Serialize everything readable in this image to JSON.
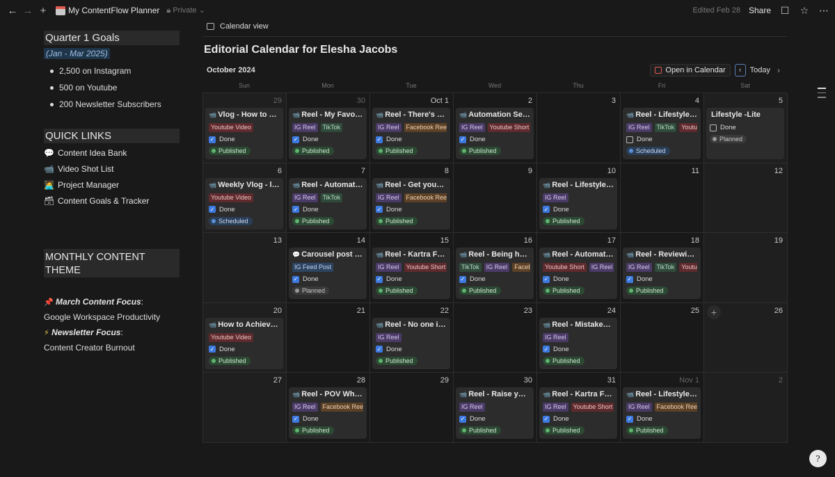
{
  "topbar": {
    "page_title": "My ContentFlow Planner",
    "privacy": "Private",
    "edited": "Edited Feb 28",
    "share": "Share"
  },
  "left": {
    "goals_heading": "Quarter 1 Goals",
    "goals_range": "(Jan - Mar 2025)",
    "goals": [
      "2,500 on Instagram",
      "500 on Youtube",
      "200 Newsletter Subscribers"
    ],
    "quick_heading": "QUICK LINKS",
    "quick_links": [
      {
        "emoji": "💬",
        "label": "Content Idea Bank"
      },
      {
        "emoji": "📹",
        "label": "Video Shot List"
      },
      {
        "emoji": "🧑‍💻",
        "label": "Project Manager"
      },
      {
        "emoji": "🗃",
        "label": "Content Goals & Tracker"
      }
    ],
    "theme_heading": "MONTHLY CONTENT THEME",
    "march_label": "March Content Focus",
    "march_value": "Google Workspace Productivity",
    "news_label": "Newsletter Focus",
    "news_value": "Content Creator Burnout",
    "pin_emoji": "📌",
    "bolt_emoji": "⚡"
  },
  "calendar": {
    "view_tab": "Calendar view",
    "title": "Editorial Calendar for Elesha Jacobs",
    "month": "October 2024",
    "open_in_calendar": "Open in Calendar",
    "today": "Today",
    "dows": [
      "Sun",
      "Mon",
      "Tue",
      "Wed",
      "Thu",
      "Fri",
      "Sat"
    ],
    "days": [
      {
        "num": "29",
        "dim": true,
        "card": {
          "emoji": "📹",
          "title": "Vlog - How to St...",
          "tags": [
            [
              "yt",
              "Youtube Video"
            ]
          ],
          "done": true,
          "status": [
            "pub",
            "Published"
          ]
        }
      },
      {
        "num": "30",
        "dim": true,
        "card": {
          "emoji": "📹",
          "title": "Reel - My Favorit...",
          "tags": [
            [
              "ig",
              "IG Reel"
            ],
            [
              "tt",
              "TikTok"
            ]
          ],
          "done": true,
          "status": [
            "pub",
            "Published"
          ]
        }
      },
      {
        "num": "Oct 1",
        "card": {
          "emoji": "📹",
          "title": "Reel - There's a ...",
          "tags": [
            [
              "ig",
              "IG Reel"
            ],
            [
              "fb",
              "Facebook Reel"
            ]
          ],
          "done": true,
          "status": [
            "pub",
            "Published"
          ]
        }
      },
      {
        "num": "2",
        "card": {
          "emoji": "📹",
          "title": "Automation Secr...",
          "tags": [
            [
              "ig",
              "IG Reel"
            ],
            [
              "yts",
              "Youtube Short"
            ]
          ],
          "done": true,
          "status": [
            "pub",
            "Published"
          ]
        }
      },
      {
        "num": "3"
      },
      {
        "num": "4",
        "card": {
          "emoji": "📹",
          "title": "Reel - Lifestyle:...",
          "tags": [
            [
              "ig",
              "IG Reel"
            ],
            [
              "tt",
              "TikTok"
            ],
            [
              "yt",
              "Youtu"
            ]
          ],
          "done": false,
          "status": [
            "sch",
            "Scheduled"
          ]
        }
      },
      {
        "num": "5",
        "card": {
          "emoji": "",
          "title": "Lifestyle -Lite",
          "tags": [],
          "done": false,
          "status": [
            "pln",
            "Planned"
          ]
        }
      },
      {
        "num": "6",
        "card": {
          "emoji": "📹",
          "title": "Weekly Vlog - le...",
          "tags": [
            [
              "yt",
              "Youtube Video"
            ]
          ],
          "done": true,
          "status": [
            "sch",
            "Scheduled"
          ]
        }
      },
      {
        "num": "7",
        "card": {
          "emoji": "📹",
          "title": "Reel - Automatio...",
          "tags": [
            [
              "ig",
              "IG Reel"
            ],
            [
              "tt",
              "TikTok"
            ]
          ],
          "done": true,
          "status": [
            "pub",
            "Published"
          ]
        }
      },
      {
        "num": "8",
        "card": {
          "emoji": "📹",
          "title": "Reel - Get your b...",
          "tags": [
            [
              "ig",
              "IG Reel"
            ],
            [
              "fb",
              "Facebook Reel"
            ]
          ],
          "done": true,
          "status": [
            "pub",
            "Published"
          ]
        }
      },
      {
        "num": "9"
      },
      {
        "num": "10",
        "card": {
          "emoji": "📹",
          "title": "Reel - Lifestyle: ...",
          "tags": [
            [
              "ig",
              "IG Reel"
            ]
          ],
          "done": true,
          "status": [
            "pub",
            "Published"
          ]
        }
      },
      {
        "num": "11"
      },
      {
        "num": "12"
      },
      {
        "num": "13"
      },
      {
        "num": "14",
        "card": {
          "emoji": "💬",
          "title": "Carousel post a...",
          "tags": [
            [
              "feed",
              "IG Feed Post"
            ]
          ],
          "done": true,
          "status": [
            "pln",
            "Planned"
          ]
        }
      },
      {
        "num": "15",
        "card": {
          "emoji": "📹",
          "title": "Reel - Kartra Fea...",
          "tags": [
            [
              "ig",
              "IG Reel"
            ],
            [
              "yts",
              "Youtube Short"
            ]
          ],
          "done": true,
          "status": [
            "pub",
            "Published"
          ]
        }
      },
      {
        "num": "16",
        "card": {
          "emoji": "📹",
          "title": "Reel - Being hel...",
          "tags": [
            [
              "tt",
              "TikTok"
            ],
            [
              "ig",
              "IG Reel"
            ],
            [
              "fb",
              "Faceb"
            ]
          ],
          "done": true,
          "status": [
            "pub",
            "Published"
          ]
        }
      },
      {
        "num": "17",
        "card": {
          "emoji": "📹",
          "title": "Reel - Automatio...",
          "tags": [
            [
              "yts",
              "Youtube Short"
            ],
            [
              "ig",
              "IG Reel"
            ]
          ],
          "done": true,
          "status": [
            "pub",
            "Published"
          ]
        }
      },
      {
        "num": "18",
        "card": {
          "emoji": "📹",
          "title": "Reel - Reviewing...",
          "tags": [
            [
              "ig",
              "IG Reel"
            ],
            [
              "tt",
              "TikTok"
            ],
            [
              "yt",
              "Youtu"
            ]
          ],
          "done": true,
          "status": [
            "pub",
            "Published"
          ]
        }
      },
      {
        "num": "19"
      },
      {
        "num": "20",
        "card": {
          "emoji": "📹",
          "title": "How to Achieve ...",
          "tags": [
            [
              "yt",
              "Youtube Video"
            ]
          ],
          "done": true,
          "status": [
            "pub",
            "Published"
          ]
        }
      },
      {
        "num": "21"
      },
      {
        "num": "22",
        "card": {
          "emoji": "📹",
          "title": "Reel - No one is ...",
          "tags": [
            [
              "ig",
              "IG Reel"
            ]
          ],
          "done": true,
          "status": [
            "pub",
            "Published"
          ]
        }
      },
      {
        "num": "23"
      },
      {
        "num": "24",
        "card": {
          "emoji": "📹",
          "title": "Reel - Mistakes ...",
          "tags": [
            [
              "ig",
              "IG Reel"
            ]
          ],
          "done": true,
          "status": [
            "pub",
            "Published"
          ]
        }
      },
      {
        "num": "25"
      },
      {
        "num": "26",
        "plus": true
      },
      {
        "num": "27"
      },
      {
        "num": "28",
        "card": {
          "emoji": "📹",
          "title": "Reel - POV Whe...",
          "tags": [
            [
              "ig",
              "IG Reel"
            ],
            [
              "fb",
              "Facebook Reel"
            ]
          ],
          "done": true,
          "status": [
            "pub",
            "Published"
          ]
        }
      },
      {
        "num": "29"
      },
      {
        "num": "30",
        "card": {
          "emoji": "📹",
          "title": "Reel - Raise your...",
          "tags": [
            [
              "ig",
              "IG Reel"
            ]
          ],
          "done": true,
          "status": [
            "pub",
            "Published"
          ]
        }
      },
      {
        "num": "31",
        "card": {
          "emoji": "📹",
          "title": "Reel - Kartra Fea...",
          "tags": [
            [
              "ig",
              "IG Reel"
            ],
            [
              "yts",
              "Youtube Short"
            ]
          ],
          "done": true,
          "status": [
            "pub",
            "Published"
          ]
        }
      },
      {
        "num": "Nov 1",
        "dim": true,
        "card": {
          "emoji": "📹",
          "title": "Reel - Lifestyle ...",
          "tags": [
            [
              "ig",
              "IG Reel"
            ],
            [
              "fb",
              "Facebook Reel"
            ]
          ],
          "done": true,
          "status": [
            "pub",
            "Published"
          ]
        }
      },
      {
        "num": "2",
        "dim": true
      }
    ],
    "done_label": "Done"
  },
  "help_glyph": "?"
}
